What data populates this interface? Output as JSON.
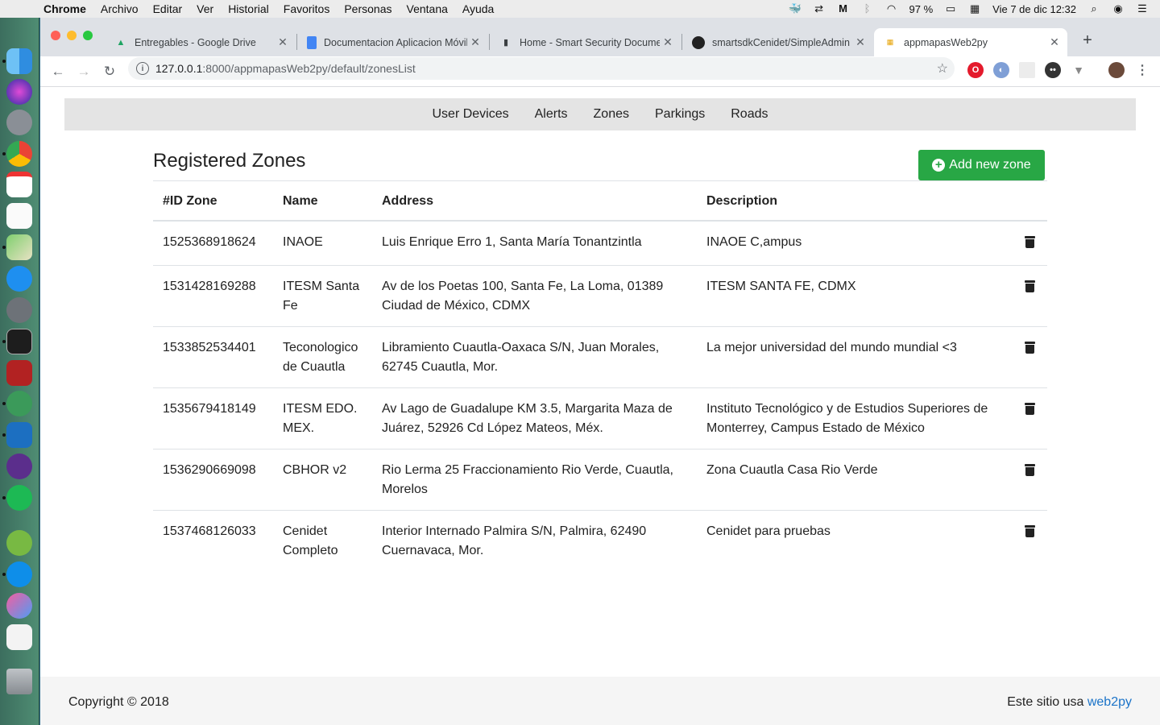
{
  "menubar": {
    "app": "Chrome",
    "items": [
      "Archivo",
      "Editar",
      "Ver",
      "Historial",
      "Favoritos",
      "Personas",
      "Ventana",
      "Ayuda"
    ],
    "battery": "97 %",
    "datetime": "Vie 7 de dic  12:32"
  },
  "tabs": [
    {
      "label": "Entregables - Google Drive",
      "icon": "google-drive-icon"
    },
    {
      "label": "Documentacion Aplicacion Móvil",
      "icon": "google-docs-icon"
    },
    {
      "label": "Home - Smart Security Documentation",
      "icon": "book-icon"
    },
    {
      "label": "smartsdkCenidet/SimpleAdmin",
      "icon": "github-icon"
    },
    {
      "label": "appmapasWeb2py",
      "icon": "web2py-icon"
    }
  ],
  "url": {
    "host": "127.0.0.1",
    "path": ":8000/appmapasWeb2py/default/zonesList"
  },
  "nav": [
    "User Devices",
    "Alerts",
    "Zones",
    "Parkings",
    "Roads"
  ],
  "page": {
    "title": "Registered Zones",
    "add_button": "Add new zone"
  },
  "table": {
    "headers": [
      "#ID Zone",
      "Name",
      "Address",
      "Description"
    ],
    "rows": [
      {
        "id": "1525368918624",
        "name": "INAOE",
        "address": "Luis Enrique Erro 1, Santa María Tonantzintla",
        "description": "INAOE C,ampus"
      },
      {
        "id": "1531428169288",
        "name": "ITESM Santa Fe",
        "address": "Av de los Poetas 100, Santa Fe, La Loma, 01389 Ciudad de México, CDMX",
        "description": "ITESM SANTA FE, CDMX"
      },
      {
        "id": "1533852534401",
        "name": "Teconologico de Cuautla",
        "address": "Libramiento Cuautla-Oaxaca S/N, Juan Morales, 62745 Cuautla, Mor.",
        "description": "La mejor universidad del mundo mundial <3"
      },
      {
        "id": "1535679418149",
        "name": "ITESM EDO. MEX.",
        "address": "Av Lago de Guadalupe KM 3.5, Margarita Maza de Juárez, 52926 Cd López Mateos, Méx.",
        "description": "Instituto Tecnológico y de Estudios Superiores de Monterrey, Campus Estado de México"
      },
      {
        "id": "1536290669098",
        "name": "CBHOR v2",
        "address": "Rio Lerma 25 Fraccionamiento Rio Verde, Cuautla, Morelos",
        "description": "Zona Cuautla Casa Rio Verde"
      },
      {
        "id": "1537468126033",
        "name": "Cenidet Completo",
        "address": "Interior Internado Palmira S/N, Palmira, 62490 Cuernavaca, Mor.",
        "description": "Cenidet para pruebas"
      }
    ]
  },
  "footer": {
    "copyright": "Copyright © 2018",
    "powered_prefix": "Este sitio usa",
    "powered_link": "web2py"
  },
  "colors": {
    "add_button": "#28a745",
    "link": "#1a73c8",
    "nav_bg": "#e4e4e4"
  }
}
